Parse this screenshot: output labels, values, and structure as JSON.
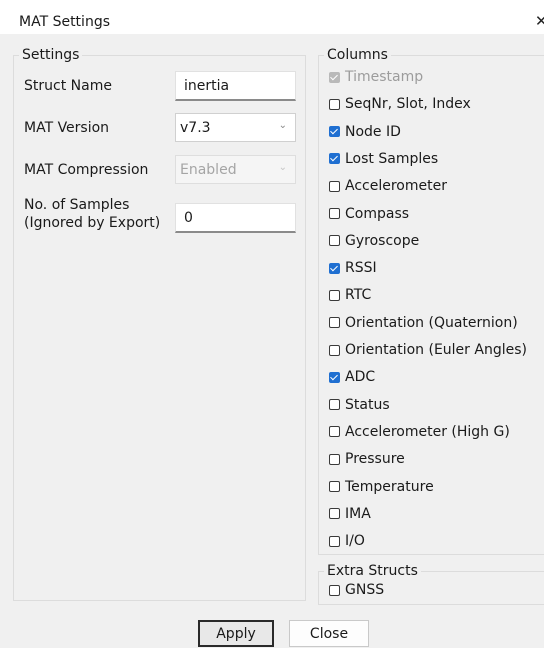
{
  "window": {
    "title": "MAT Settings",
    "close_glyph": "✕"
  },
  "settings": {
    "legend": "Settings",
    "struct_name": {
      "label": "Struct Name",
      "value": "inertia"
    },
    "mat_version": {
      "label": "MAT Version",
      "value": "v7.3"
    },
    "mat_compression": {
      "label": "MAT Compression",
      "value": "Enabled"
    },
    "samples": {
      "label_line1": "No. of Samples",
      "label_line2": "(Ignored by Export)",
      "value": "0"
    }
  },
  "columns": {
    "legend": "Columns",
    "items": [
      {
        "label": "Timestamp",
        "checked": true,
        "disabled": true
      },
      {
        "label": "SeqNr, Slot, Index",
        "checked": false,
        "disabled": false
      },
      {
        "label": "Node ID",
        "checked": true,
        "disabled": false
      },
      {
        "label": "Lost Samples",
        "checked": true,
        "disabled": false
      },
      {
        "label": "Accelerometer",
        "checked": false,
        "disabled": false
      },
      {
        "label": "Compass",
        "checked": false,
        "disabled": false
      },
      {
        "label": "Gyroscope",
        "checked": false,
        "disabled": false
      },
      {
        "label": "RSSI",
        "checked": true,
        "disabled": false
      },
      {
        "label": "RTC",
        "checked": false,
        "disabled": false
      },
      {
        "label": "Orientation (Quaternion)",
        "checked": false,
        "disabled": false
      },
      {
        "label": "Orientation (Euler Angles)",
        "checked": false,
        "disabled": false
      },
      {
        "label": "ADC",
        "checked": true,
        "disabled": false
      },
      {
        "label": "Status",
        "checked": false,
        "disabled": false
      },
      {
        "label": "Accelerometer (High G)",
        "checked": false,
        "disabled": false
      },
      {
        "label": "Pressure",
        "checked": false,
        "disabled": false
      },
      {
        "label": "Temperature",
        "checked": false,
        "disabled": false
      },
      {
        "label": "IMA",
        "checked": false,
        "disabled": false
      },
      {
        "label": "I/O",
        "checked": false,
        "disabled": false
      }
    ]
  },
  "extra": {
    "legend": "Extra Structs",
    "items": [
      {
        "label": "GNSS",
        "checked": false,
        "disabled": false
      }
    ]
  },
  "buttons": {
    "apply": "Apply",
    "close": "Close"
  }
}
